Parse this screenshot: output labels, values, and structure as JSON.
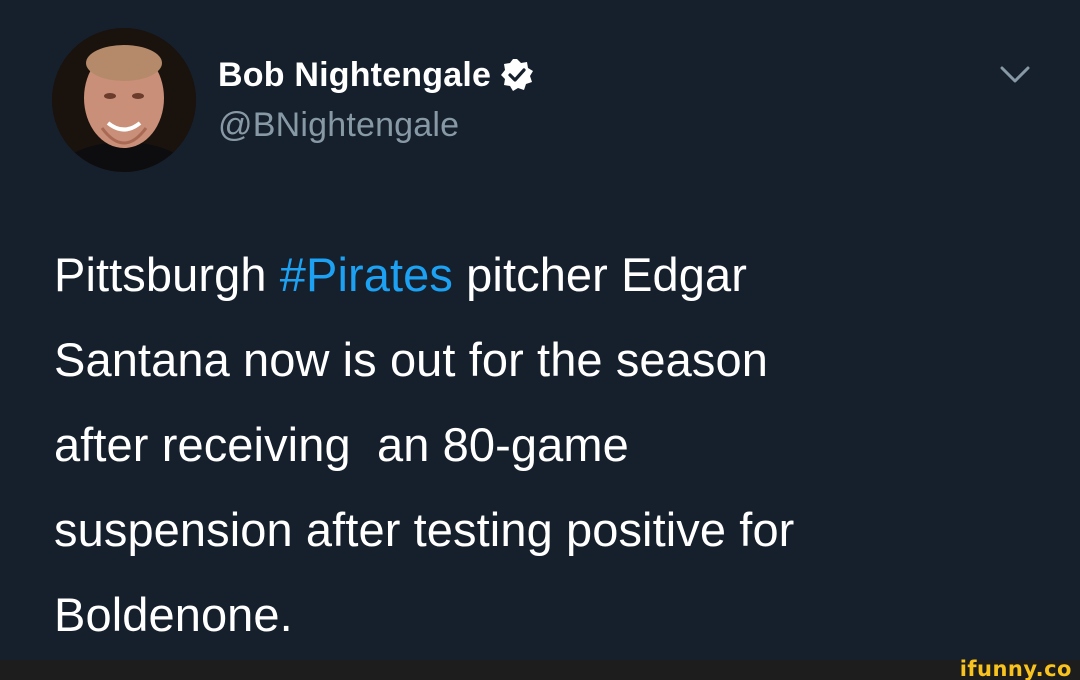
{
  "tweet": {
    "author": {
      "display_name": "Bob Nightengale",
      "handle": "@BNightengale",
      "verified": true
    },
    "text_parts": [
      {
        "text": "Pittsburgh ",
        "type": "text"
      },
      {
        "text": "#Pirates",
        "type": "hashtag"
      },
      {
        "text": " pitcher Edgar\nSantana now is out for the season\nafter receiving  an 80-game\nsuspension after testing positive for\nBoldenone.",
        "type": "text"
      }
    ]
  },
  "icons": {
    "avatar": "profile-photo",
    "verified": "verified-badge-icon",
    "menu": "chevron-down-icon"
  },
  "colors": {
    "background": "#16202c",
    "text": "#ffffff",
    "secondary_text": "#8899a6",
    "hashtag": "#1da1f2",
    "watermark": "#f8c31e"
  },
  "watermark": {
    "text": "ifunny.co"
  }
}
